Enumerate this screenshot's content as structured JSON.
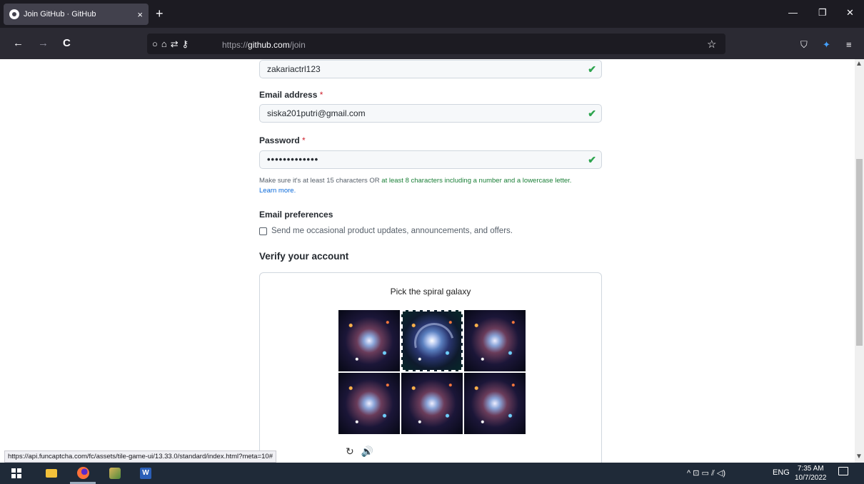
{
  "browser": {
    "tab_title": "Join GitHub · GitHub",
    "tab_close": "×",
    "new_tab": "+",
    "window_controls": {
      "minimize": "—",
      "restore": "❐",
      "close": "✕"
    },
    "nav": {
      "back": "←",
      "forward": "→",
      "reload": "C"
    },
    "url_prefix": "https://",
    "url_host": "github.com",
    "url_path": "/join",
    "bookmark_star": "☆",
    "right_icons": [
      "⛉",
      "✦",
      "≡"
    ],
    "status_url": "https://api.funcaptcha.com/fc/assets/tile-game-ui/13.33.0/standard/index.html?meta=10#"
  },
  "form": {
    "username_value": "zakariactrl123",
    "email_label": "Email address",
    "email_value": "siska201putri@gmail.com",
    "password_label": "Password",
    "password_value": "•••••••••••••",
    "required_mark": "*",
    "check_mark": "✔",
    "hint_start": "Make sure it's at least 15 characters OR ",
    "hint_green": "at least 8 characters including a number and a lowercase letter.",
    "hint_link": "Learn more.",
    "prefs_label": "Email preferences",
    "prefs_checkbox": "Send me occasional product updates, announcements, and offers.",
    "verify_title": "Verify your account"
  },
  "captcha": {
    "question": "Pick the spiral galaxy",
    "controls": [
      "↻",
      "🔊"
    ]
  },
  "taskbar": {
    "word_letter": "W",
    "tray_icons": "^  ⊡  ▭  ⫽  ◁)",
    "language": "ENG",
    "time": "7:35 AM",
    "date": "10/7/2022"
  }
}
